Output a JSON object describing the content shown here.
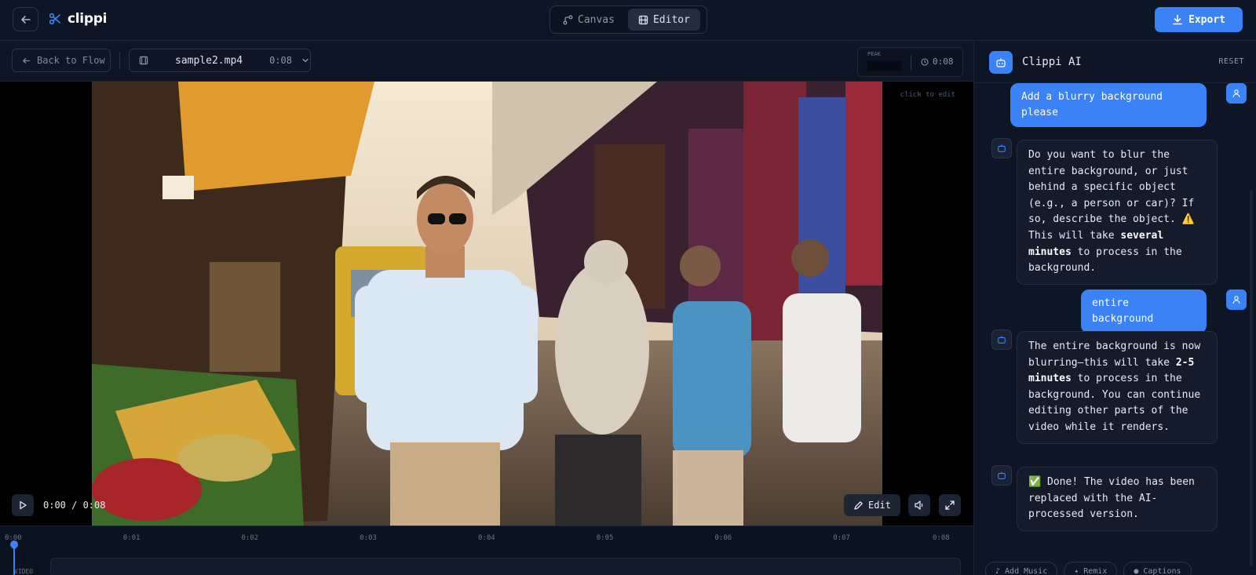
{
  "app": {
    "name": "clippi"
  },
  "header": {
    "tabs": [
      {
        "label": "Canvas",
        "active": false
      },
      {
        "label": "Editor",
        "active": true
      }
    ],
    "export_label": "Export",
    "accent": "#3b82f6"
  },
  "toolbar": {
    "back_label": "Back to Flow",
    "file_name": "sample2.mp4",
    "file_duration": "0:08",
    "peak_label": "PEAK",
    "duration": "0:08"
  },
  "player": {
    "hint": "click to edit",
    "time": "0:00 / 0:08",
    "edit_label": "Edit",
    "progress": 0
  },
  "timeline": {
    "ticks": [
      "0:00",
      "0:01",
      "0:02",
      "0:03",
      "0:04",
      "0:05",
      "0:06",
      "0:07",
      "0:08"
    ],
    "track_label": "VIDEO"
  },
  "assistant": {
    "title": "Clippi AI",
    "reset_label": "RESET",
    "messages": [
      {
        "role": "user",
        "text": "Add a blurry background please"
      },
      {
        "role": "bot",
        "parts": [
          {
            "t": "Do you want to blur the entire background, or just behind a specific object (e.g., a person or car)? If so, describe the object. ⚠️ This will take "
          },
          {
            "b": "several minutes"
          },
          {
            "t": " to process in the background."
          }
        ]
      },
      {
        "role": "user",
        "text": "entire background"
      },
      {
        "role": "bot",
        "parts": [
          {
            "t": "The entire background is now blurring—this will take "
          },
          {
            "b": "2-5 minutes"
          },
          {
            "t": " to process in the background. You can continue editing other parts of the video while it renders."
          }
        ]
      },
      {
        "role": "bot",
        "parts": [
          {
            "t": "✅ Done! The video has been replaced with the AI-processed version."
          }
        ]
      }
    ],
    "chips": [
      "Add Music",
      "Remix",
      "Captions"
    ]
  }
}
